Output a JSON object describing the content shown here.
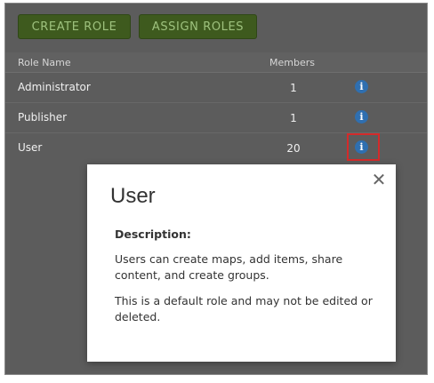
{
  "toolbar": {
    "create_role_label": "CREATE ROLE",
    "assign_roles_label": "ASSIGN ROLES"
  },
  "table": {
    "columns": [
      "Role Name",
      "Members"
    ],
    "rows": [
      {
        "name": "Administrator",
        "members": "1",
        "icon": "info-icon"
      },
      {
        "name": "Publisher",
        "members": "1",
        "icon": "info-icon"
      },
      {
        "name": "User",
        "members": "20",
        "icon": "info-icon"
      }
    ]
  },
  "modal": {
    "title": "User",
    "description_label": "Description:",
    "description_text": "Users can create maps, add items, share content, and create groups.",
    "default_text": "This is a default role and may not be edited or deleted.",
    "close_icon": "close-icon"
  },
  "colors": {
    "button_bg": "#3e5a1e",
    "button_text": "#9ec27e",
    "info_icon": "#2f6fb0",
    "highlight": "#d42a2a",
    "overlay_bg": "#5c5c5c"
  }
}
